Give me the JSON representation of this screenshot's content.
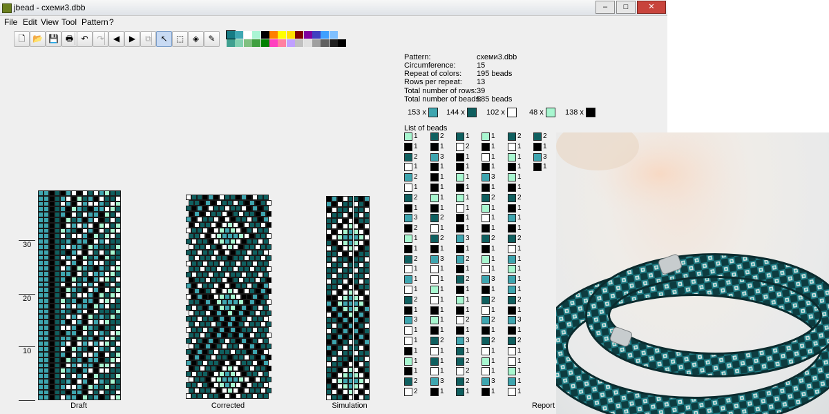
{
  "window": {
    "title": "jbead - схеми3.dbb"
  },
  "menu": [
    "File",
    "Edit",
    "View",
    "Tool",
    "Pattern",
    "?"
  ],
  "toolbar": [
    {
      "name": "new-icon",
      "glyph": "🗋"
    },
    {
      "name": "open-icon",
      "glyph": "📂"
    },
    {
      "name": "save-icon",
      "glyph": "💾"
    },
    {
      "name": "print-icon",
      "glyph": "🖶"
    },
    {
      "name": "undo-icon",
      "glyph": "↶"
    },
    {
      "name": "redo-icon",
      "glyph": "↷"
    },
    {
      "name": "scroll-left-icon",
      "glyph": "◀"
    },
    {
      "name": "scroll-right-icon",
      "glyph": "▶"
    },
    {
      "name": "copy-icon",
      "glyph": "⧉"
    },
    {
      "name": "pointer-icon",
      "glyph": "↖"
    },
    {
      "name": "select-icon",
      "glyph": "⬚"
    },
    {
      "name": "fill-icon",
      "glyph": "◈"
    },
    {
      "name": "pipette-icon",
      "glyph": "✎"
    }
  ],
  "palette": [
    "#167b84",
    "#3fa7b2",
    "#ffffff",
    "#aaf5d4",
    "#000000",
    "#ff8000",
    "#ffff00",
    "#ffe000",
    "#800000",
    "#8000a0",
    "#4040c0",
    "#40a0ff",
    "#80c0ff",
    "#40a090",
    "#80d0b0",
    "#80c080",
    "#40a040",
    "#008000",
    "#ff40c0",
    "#ff80a0",
    "#c0a0ff",
    "#c0c0c0",
    "#e0e0e0",
    "#a0a0a0",
    "#606060",
    "#202020",
    "#000000"
  ],
  "colors": {
    "dark_teal": "#0f5f5f",
    "teal": "#3ea5af",
    "white": "#ffffff",
    "mint": "#a8f7d0",
    "black": "#000000"
  },
  "ruler": [
    "30",
    "20",
    "10"
  ],
  "views": {
    "draft": "Draft",
    "corrected": "Corrected",
    "simulation": "Simulation",
    "report": "Report"
  },
  "info": [
    {
      "key": "Pattern:",
      "value": "схеми3.dbb"
    },
    {
      "key": "Circumference:",
      "value": "15"
    },
    {
      "key": "Repeat of colors:",
      "value": "195 beads"
    },
    {
      "key": "Rows per repeat:",
      "value": "13"
    },
    {
      "key": "Total number of rows:",
      "value": "39"
    },
    {
      "key": "Total number of beads:",
      "value": "585 beads"
    }
  ],
  "color_counts": [
    {
      "label": "153 x",
      "color": "#3ea5af"
    },
    {
      "label": "144 x",
      "color": "#0f5f5f"
    },
    {
      "label": "102 x",
      "color": "#ffffff"
    },
    {
      "label": "48 x",
      "color": "#a8f7d0"
    },
    {
      "label": "138 x",
      "color": "#000000"
    }
  ],
  "bead_list_title": "List of beads",
  "bead_list": [
    [
      [
        "M",
        1
      ],
      [
        "K",
        1
      ],
      [
        "D",
        2
      ],
      [
        "W",
        1
      ],
      [
        "T",
        2
      ],
      [
        "W",
        1
      ],
      [
        "D",
        2
      ],
      [
        "K",
        1
      ],
      [
        "T",
        3
      ],
      [
        "K",
        2
      ],
      [
        "M",
        1
      ],
      [
        "K",
        1
      ],
      [
        "D",
        2
      ],
      [
        "W",
        1
      ],
      [
        "T",
        1
      ],
      [
        "W",
        1
      ],
      [
        "D",
        2
      ],
      [
        "K",
        1
      ],
      [
        "T",
        3
      ],
      [
        "W",
        1
      ],
      [
        "W",
        1
      ],
      [
        "K",
        1
      ],
      [
        "M",
        1
      ],
      [
        "K",
        1
      ],
      [
        "D",
        2
      ],
      [
        "W",
        2
      ]
    ],
    [
      [
        "D",
        2
      ],
      [
        "K",
        1
      ],
      [
        "T",
        3
      ],
      [
        "K",
        1
      ],
      [
        "K",
        1
      ],
      [
        "K",
        1
      ],
      [
        "M",
        1
      ],
      [
        "K",
        1
      ],
      [
        "D",
        2
      ],
      [
        "W",
        1
      ],
      [
        "D",
        2
      ],
      [
        "K",
        1
      ],
      [
        "T",
        3
      ],
      [
        "W",
        1
      ],
      [
        "W",
        1
      ],
      [
        "M",
        1
      ],
      [
        "W",
        1
      ],
      [
        "K",
        1
      ],
      [
        "M",
        1
      ],
      [
        "K",
        1
      ],
      [
        "D",
        2
      ],
      [
        "W",
        1
      ],
      [
        "D",
        1
      ],
      [
        "W",
        1
      ],
      [
        "T",
        3
      ],
      [
        "K",
        1
      ]
    ],
    [
      [
        "D",
        1
      ],
      [
        "W",
        2
      ],
      [
        "K",
        1
      ],
      [
        "K",
        1
      ],
      [
        "M",
        1
      ],
      [
        "K",
        1
      ],
      [
        "M",
        1
      ],
      [
        "W",
        1
      ],
      [
        "K",
        1
      ],
      [
        "K",
        1
      ],
      [
        "T",
        3
      ],
      [
        "K",
        1
      ],
      [
        "T",
        2
      ],
      [
        "K",
        1
      ],
      [
        "D",
        2
      ],
      [
        "K",
        1
      ],
      [
        "M",
        1
      ],
      [
        "K",
        1
      ],
      [
        "W",
        2
      ],
      [
        "K",
        1
      ],
      [
        "T",
        3
      ],
      [
        "D",
        1
      ],
      [
        "D",
        2
      ],
      [
        "W",
        2
      ],
      [
        "D",
        2
      ],
      [
        "D",
        1
      ]
    ],
    [
      [
        "M",
        1
      ],
      [
        "K",
        1
      ],
      [
        "W",
        1
      ],
      [
        "K",
        1
      ],
      [
        "T",
        3
      ],
      [
        "K",
        1
      ],
      [
        "D",
        2
      ],
      [
        "M",
        1
      ],
      [
        "W",
        1
      ],
      [
        "K",
        1
      ],
      [
        "D",
        2
      ],
      [
        "K",
        1
      ],
      [
        "M",
        1
      ],
      [
        "W",
        1
      ],
      [
        "T",
        3
      ],
      [
        "K",
        1
      ],
      [
        "D",
        2
      ],
      [
        "W",
        1
      ],
      [
        "T",
        2
      ],
      [
        "K",
        1
      ],
      [
        "D",
        2
      ],
      [
        "W",
        1
      ],
      [
        "M",
        1
      ],
      [
        "W",
        1
      ],
      [
        "T",
        3
      ],
      [
        "K",
        1
      ]
    ],
    [
      [
        "D",
        2
      ],
      [
        "W",
        1
      ],
      [
        "M",
        1
      ],
      [
        "K",
        1
      ],
      [
        "M",
        1
      ],
      [
        "K",
        1
      ],
      [
        "D",
        2
      ],
      [
        "K",
        1
      ],
      [
        "T",
        1
      ],
      [
        "K",
        1
      ],
      [
        "D",
        2
      ],
      [
        "W",
        1
      ],
      [
        "T",
        1
      ],
      [
        "M",
        1
      ],
      [
        "T",
        1
      ],
      [
        "T",
        1
      ],
      [
        "D",
        2
      ],
      [
        "K",
        1
      ],
      [
        "T",
        3
      ],
      [
        "K",
        1
      ],
      [
        "D",
        2
      ],
      [
        "W",
        1
      ],
      [
        "W",
        1
      ],
      [
        "M",
        1
      ],
      [
        "T",
        1
      ],
      [
        "W",
        1
      ]
    ],
    [
      [
        "D",
        2
      ],
      [
        "K",
        1
      ],
      [
        "T",
        3
      ],
      [
        "K",
        1
      ]
    ]
  ],
  "photo": {
    "caption": ""
  }
}
